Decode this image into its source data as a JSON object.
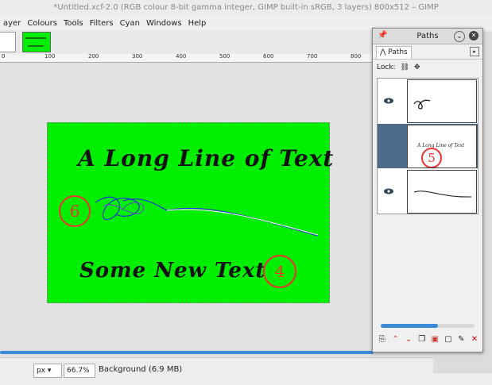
{
  "window_title": "*Untitled.xcf-2.0 (RGB colour 8-bit gamma integer, GIMP built-in sRGB, 3 layers) 800x512 – GIMP",
  "menu": [
    "ayer",
    "Colours",
    "Tools",
    "Filters",
    "Cyan",
    "Windows",
    "Help"
  ],
  "ruler_labels": [
    "0",
    "100",
    "200",
    "300",
    "400",
    "500",
    "600",
    "700",
    "800"
  ],
  "canvas": {
    "line1": "A Long Line of Text",
    "line2": "Some New Text",
    "marker_left": "6",
    "marker_right": "4",
    "image_color": "#00ee00"
  },
  "statusbar": {
    "unit": "px",
    "zoom": "66.7%",
    "layer_info": "Background (6.9 MB)"
  },
  "paths_dialog": {
    "title": "Paths",
    "tab_label": "Paths",
    "lock_label": "Lock:",
    "thumb_text": "A Long Line of Text",
    "marker": "5",
    "buttons": [
      "new-path",
      "raise",
      "lower",
      "duplicate",
      "path-to-selection",
      "selection-to-path",
      "paint-along",
      "delete"
    ]
  },
  "colors": {
    "selection": "#4b6b8b",
    "accent": "#3b8ad8",
    "marker": "#e33333"
  }
}
